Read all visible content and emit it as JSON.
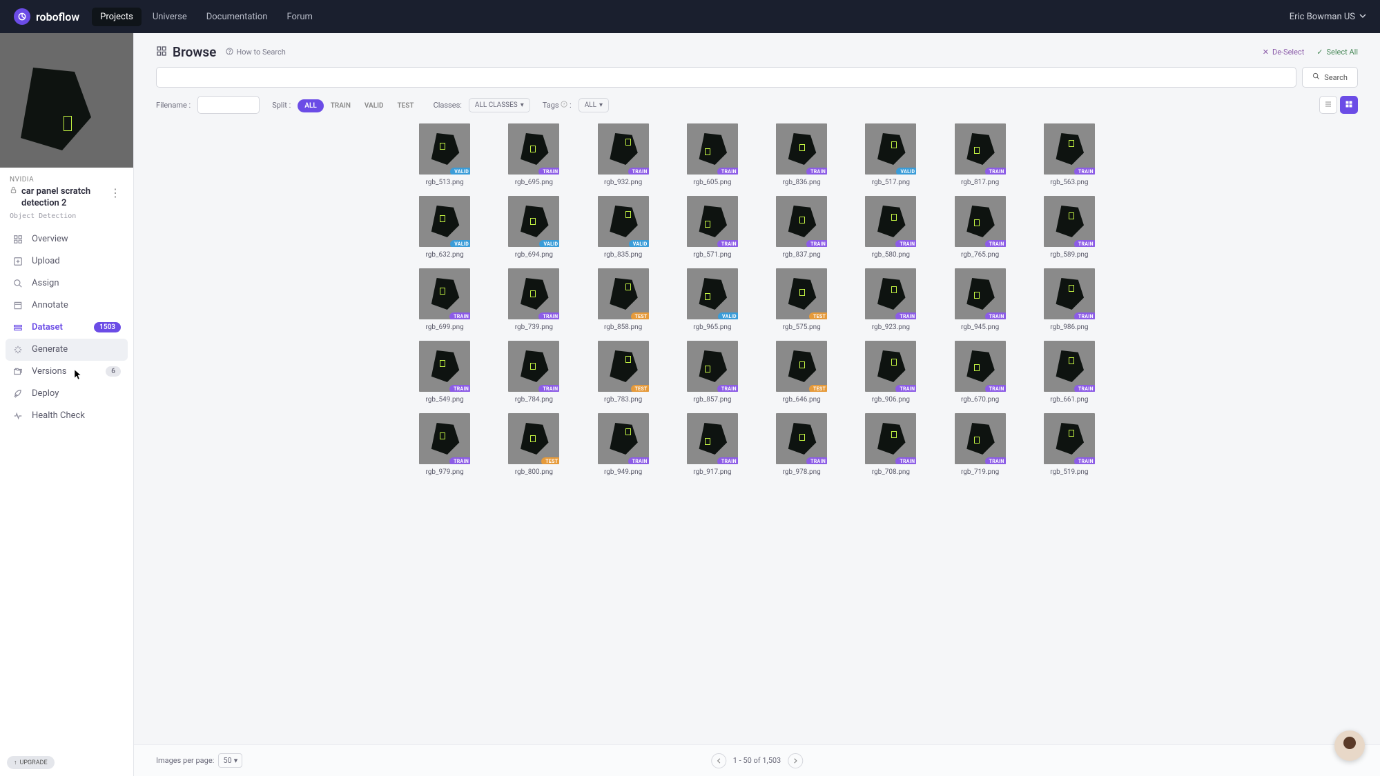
{
  "brand": "roboflow",
  "nav": {
    "items": [
      "Projects",
      "Universe",
      "Documentation",
      "Forum"
    ],
    "active": 0
  },
  "user": {
    "name": "Eric Bowman US"
  },
  "project": {
    "org": "NVIDIA",
    "name": "car panel scratch detection 2",
    "type": "Object Detection"
  },
  "sidebar": {
    "items": [
      {
        "label": "Overview",
        "icon": "grid"
      },
      {
        "label": "Upload",
        "icon": "plus"
      },
      {
        "label": "Assign",
        "icon": "search"
      },
      {
        "label": "Annotate",
        "icon": "box"
      },
      {
        "label": "Dataset",
        "icon": "layers",
        "active": true,
        "badge": "1503"
      },
      {
        "label": "Generate",
        "icon": "sparkle",
        "hover": true
      },
      {
        "label": "Versions",
        "icon": "folders",
        "badge": "6",
        "muted": true
      },
      {
        "label": "Deploy",
        "icon": "rocket"
      },
      {
        "label": "Health Check",
        "icon": "pulse"
      }
    ],
    "upgrade": "UPGRADE"
  },
  "page": {
    "title": "Browse",
    "howto": "How to Search",
    "deselect": "De-Select",
    "selectall": "Select All",
    "search_btn": "Search",
    "filters": {
      "filename_lbl": "Filename :",
      "split_lbl": "Split :",
      "splits": [
        "ALL",
        "TRAIN",
        "VALID",
        "TEST"
      ],
      "classes_lbl": "Classes:",
      "classes_chip": "ALL CLASSES",
      "tags_lbl": "Tags",
      "tags_chip": "ALL"
    }
  },
  "footer": {
    "perpage_lbl": "Images per page:",
    "perpage_val": "50",
    "range": "1 - 50 of 1,503"
  },
  "images": [
    {
      "f": "rgb_513.png",
      "s": "valid"
    },
    {
      "f": "rgb_695.png",
      "s": "train"
    },
    {
      "f": "rgb_932.png",
      "s": "train"
    },
    {
      "f": "rgb_605.png",
      "s": "train"
    },
    {
      "f": "rgb_836.png",
      "s": "train"
    },
    {
      "f": "rgb_517.png",
      "s": "valid"
    },
    {
      "f": "rgb_817.png",
      "s": "train"
    },
    {
      "f": "rgb_563.png",
      "s": "train"
    },
    {
      "f": "rgb_632.png",
      "s": "valid"
    },
    {
      "f": "rgb_694.png",
      "s": "valid"
    },
    {
      "f": "rgb_835.png",
      "s": "valid"
    },
    {
      "f": "rgb_571.png",
      "s": "train"
    },
    {
      "f": "rgb_837.png",
      "s": "train"
    },
    {
      "f": "rgb_580.png",
      "s": "train"
    },
    {
      "f": "rgb_765.png",
      "s": "train"
    },
    {
      "f": "rgb_589.png",
      "s": "train"
    },
    {
      "f": "rgb_699.png",
      "s": "train"
    },
    {
      "f": "rgb_739.png",
      "s": "train"
    },
    {
      "f": "rgb_858.png",
      "s": "test"
    },
    {
      "f": "rgb_965.png",
      "s": "valid"
    },
    {
      "f": "rgb_575.png",
      "s": "test"
    },
    {
      "f": "rgb_923.png",
      "s": "train"
    },
    {
      "f": "rgb_945.png",
      "s": "train"
    },
    {
      "f": "rgb_986.png",
      "s": "train"
    },
    {
      "f": "rgb_549.png",
      "s": "train"
    },
    {
      "f": "rgb_784.png",
      "s": "train"
    },
    {
      "f": "rgb_783.png",
      "s": "test"
    },
    {
      "f": "rgb_857.png",
      "s": "train"
    },
    {
      "f": "rgb_646.png",
      "s": "test"
    },
    {
      "f": "rgb_906.png",
      "s": "train"
    },
    {
      "f": "rgb_670.png",
      "s": "train"
    },
    {
      "f": "rgb_661.png",
      "s": "train"
    },
    {
      "f": "rgb_979.png",
      "s": "train"
    },
    {
      "f": "rgb_800.png",
      "s": "test"
    },
    {
      "f": "rgb_949.png",
      "s": "train"
    },
    {
      "f": "rgb_917.png",
      "s": "train"
    },
    {
      "f": "rgb_978.png",
      "s": "train"
    },
    {
      "f": "rgb_708.png",
      "s": "train"
    },
    {
      "f": "rgb_719.png",
      "s": "train"
    },
    {
      "f": "rgb_519.png",
      "s": "train"
    }
  ]
}
